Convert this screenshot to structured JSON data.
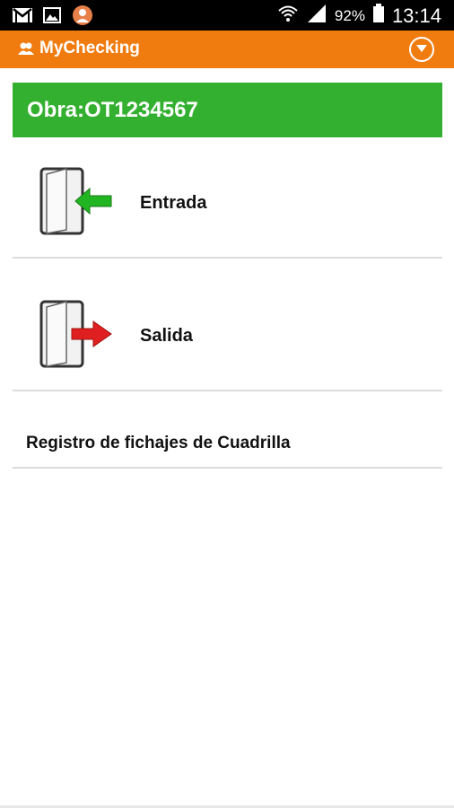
{
  "status_bar": {
    "battery_percent": "92%",
    "time": "13:14",
    "icons": [
      "gmail-icon",
      "gallery-icon",
      "avatar-icon",
      "wifi-icon",
      "signal-icon",
      "battery-icon"
    ]
  },
  "app_bar": {
    "title": "MyChecking",
    "icons": [
      "people-logo-icon",
      "dropdown-menu-icon"
    ]
  },
  "obra": {
    "label": "Obra:OT1234567"
  },
  "menu": {
    "items": [
      {
        "label": "Entrada",
        "icon": "door-enter-icon",
        "arrow_color": "#22b522"
      },
      {
        "label": "Salida",
        "icon": "door-exit-icon",
        "arrow_color": "#e02020"
      },
      {
        "label": "Registro de fichajes de Cuadrilla"
      }
    ]
  },
  "colors": {
    "app_bar": "#f07c10",
    "obra_bar": "#34b030"
  }
}
